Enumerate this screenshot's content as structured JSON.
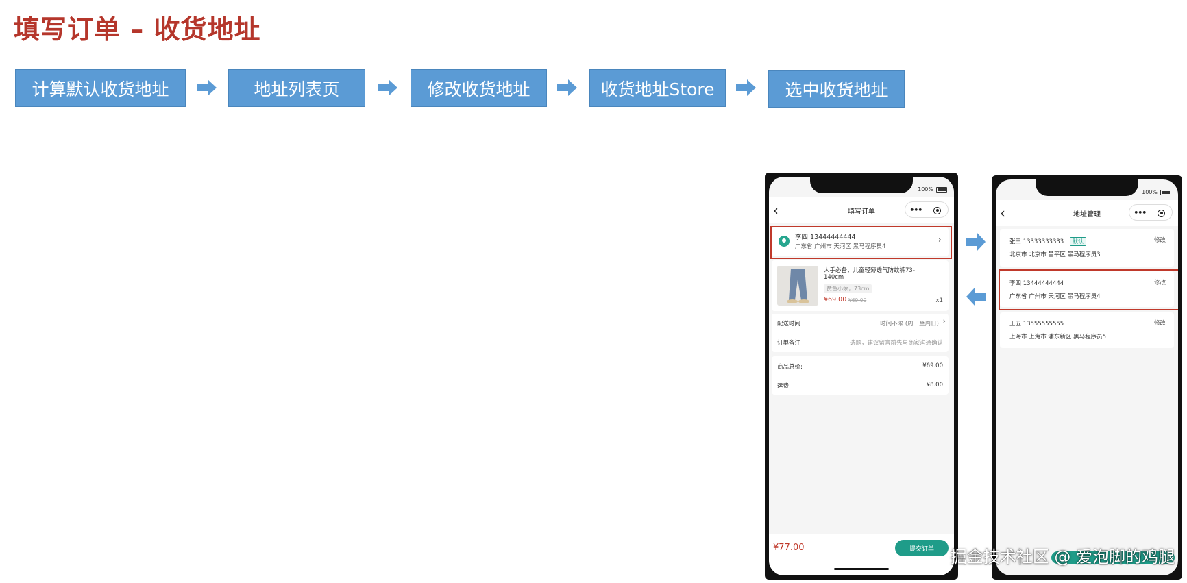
{
  "title": "填写订单 – 收货地址",
  "flow_steps": [
    "计算默认收货地址",
    "地址列表页",
    "修改收货地址",
    "收货地址Store",
    "选中收货地址"
  ],
  "colors": {
    "title": "#b5362b",
    "flow_box": "#5b9bd5",
    "accent_green": "#1f9c89",
    "highlight_red": "#c0392b",
    "price_red": "#c0392b"
  },
  "order_phone": {
    "battery": "100%",
    "nav_title": "填写订单",
    "address": {
      "name_phone": "李四 13444444444",
      "detail": "广东省 广州市 天河区 黑马程序员4"
    },
    "product": {
      "name_line1": "人手必备，儿童轻薄透气防蚊裤73-",
      "name_line2": "140cm",
      "spec": "黄色小象，73cm",
      "price": "¥69.00",
      "original_price": "¥69.00",
      "quantity": "x1"
    },
    "delivery_label": "配送时间",
    "delivery_value": "时间不限 (周一至周日)",
    "remark_label": "订单备注",
    "remark_placeholder": "选题，建议留言前先与商家沟通确认",
    "goods_total_label": "商品总价:",
    "goods_total_value": "¥69.00",
    "freight_label": "运费:",
    "freight_value": "¥8.00",
    "total": "¥77.00",
    "submit_label": "提交订单"
  },
  "address_phone": {
    "battery": "100%",
    "nav_title": "地址管理",
    "default_tag": "默认",
    "edit_label": "修改",
    "addresses": [
      {
        "name_phone": "张三 13333333333",
        "detail": "北京市 北京市 昌平区 黑马程序员3"
      },
      {
        "name_phone": "李四 13444444444",
        "detail": "广东省 广州市 天河区 黑马程序员4"
      },
      {
        "name_phone": "王五 13555555555",
        "detail": "上海市 上海市 浦东新区 黑马程序员5"
      }
    ]
  },
  "watermark": "掘金技术社区 @ 爱泡脚的鸡腿"
}
